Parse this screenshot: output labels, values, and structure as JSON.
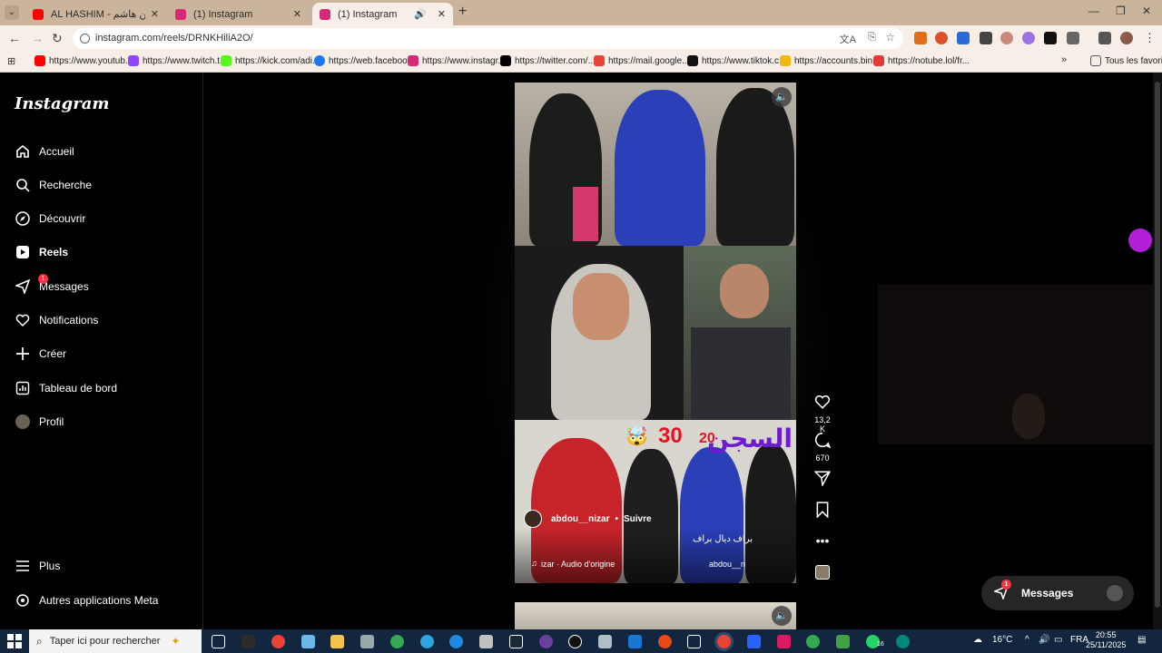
{
  "browser": {
    "tabs": [
      {
        "label": "AL HASHIM - حسين هاشم - YouT",
        "fav_color": "#ff0000"
      },
      {
        "label": "(1) Instagram",
        "fav_color": "#d62976"
      },
      {
        "label": "(1) Instagram",
        "fav_color": "#d62976"
      }
    ],
    "url": "instagram.com/reels/DRNKHiliA2O/",
    "bookmarks": [
      {
        "label": "https://www.youtub...",
        "color": "#ff0000"
      },
      {
        "label": "https://www.twitch.t...",
        "color": "#9146ff"
      },
      {
        "label": "https://kick.com/adi...",
        "color": "#53fc18"
      },
      {
        "label": "https://web.faceboo...",
        "color": "#1877f2"
      },
      {
        "label": "https://www.instagr...",
        "color": "#d62976"
      },
      {
        "label": "https://twitter.com/...",
        "color": "#000000"
      },
      {
        "label": "https://mail.google...",
        "color": "#ea4335"
      },
      {
        "label": "https://www.tiktok.c...",
        "color": "#111111"
      },
      {
        "label": "https://accounts.bin...",
        "color": "#f0b90b"
      },
      {
        "label": "https://notube.lol/fr...",
        "color": "#e53935"
      }
    ],
    "all_bookmarks": "Tous les favoris"
  },
  "instagram": {
    "logo": "Instagram",
    "nav": [
      {
        "label": "Accueil",
        "icon": "home-icon"
      },
      {
        "label": "Recherche",
        "icon": "search-icon"
      },
      {
        "label": "Découvrir",
        "icon": "compass-icon"
      },
      {
        "label": "Reels",
        "icon": "reels-icon",
        "active": true
      },
      {
        "label": "Messages",
        "icon": "messenger-icon",
        "badge": "1"
      },
      {
        "label": "Notifications",
        "icon": "heart-icon"
      },
      {
        "label": "Créer",
        "icon": "plus-icon"
      },
      {
        "label": "Tableau de bord",
        "icon": "chart-icon"
      },
      {
        "label": "Profil",
        "icon": "avatar"
      }
    ],
    "more": "Plus",
    "meta_apps": "Autres applications Meta",
    "reel": {
      "username": "abdou__nizar",
      "follow": "Suivre",
      "caption": "براف ديال براف",
      "audio": "izar · Audio d'origine",
      "audio_right": "abdou__n",
      "overlay_title": "السجن",
      "overlay_num_big": "30",
      "overlay_num_small": "20",
      "emoji": "🤯",
      "likes": "13,2 K",
      "comments": "670"
    },
    "messages_pill": {
      "label": "Messages",
      "badge": "1"
    }
  },
  "taskbar": {
    "search_placeholder": "Taper ici pour rechercher",
    "weather": "16°C",
    "lang": "FRA",
    "time": "20:55",
    "date": "25/11/2025",
    "notif_count": "16"
  }
}
